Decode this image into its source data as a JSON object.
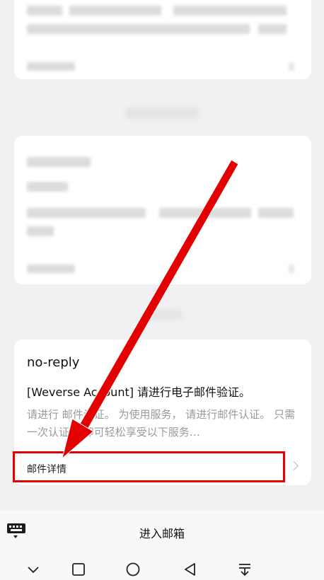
{
  "email": {
    "sender": "no-reply",
    "subject": "[Weverse Account] 请进行电子邮件验证。",
    "preview": "请进行 邮件认证。 为使用服务， 请进行邮件认证。 只需一次认证， 即可轻松享受以下服务…",
    "details_label": "邮件详情"
  },
  "bottom_bar": {
    "enter_mailbox": "进入邮箱"
  },
  "nav_icons": [
    "chevron-down-icon",
    "recents-square-icon",
    "home-circle-icon",
    "back-triangle-icon",
    "notification-pull-icon"
  ],
  "colors": {
    "annotation_red": "#e20000",
    "background": "#f1f1f3"
  }
}
